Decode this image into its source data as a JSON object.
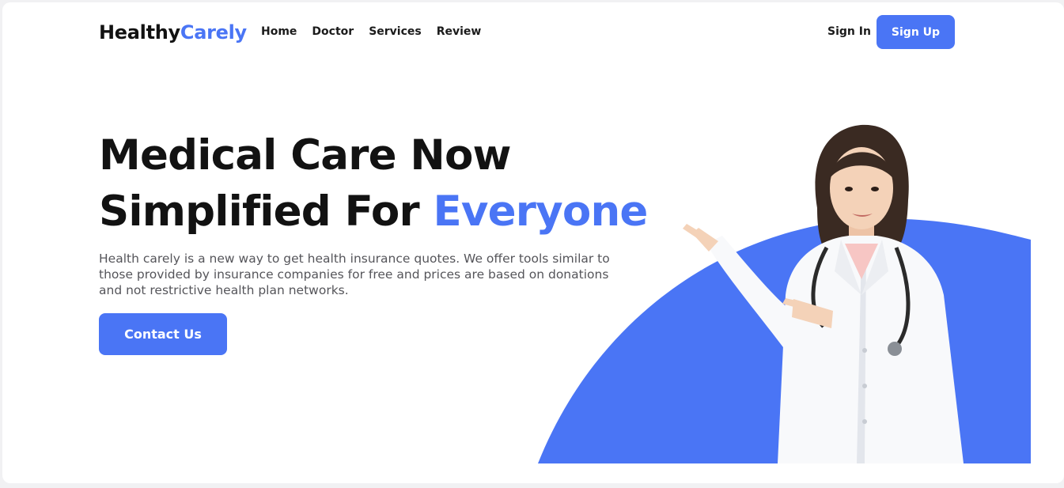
{
  "brand": {
    "name_part1": "Healthy",
    "name_part2": "Carely",
    "accent_color": "#4a75f5"
  },
  "nav": {
    "links": [
      "Home",
      "Doctor",
      "Services",
      "Review"
    ],
    "sign_in": "Sign In",
    "sign_up": "Sign Up"
  },
  "hero": {
    "title_line1": "Medical Care Now",
    "title_line2_part1": "Simplified For ",
    "title_line2_accent": "Everyone",
    "description": "Health carely is a new way to get health insurance quotes. We offer tools similar to those provided by insurance companies for free and prices are based on donations and not restrictive health plan networks.",
    "cta": "Contact Us",
    "image_icon": "doctor-illustration"
  }
}
